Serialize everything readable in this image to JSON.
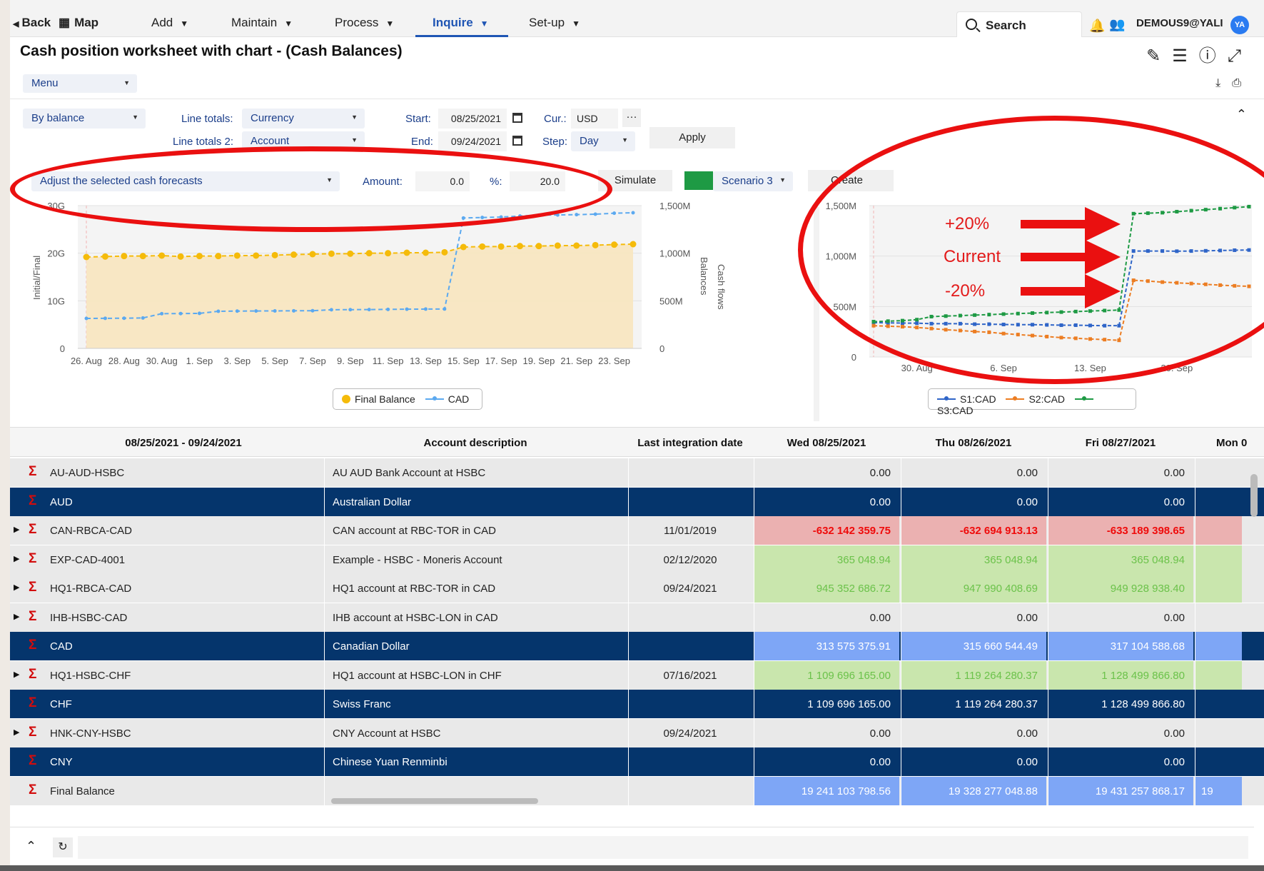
{
  "nav": {
    "back": "Back",
    "map": "Map",
    "items": [
      "Add",
      "Maintain",
      "Process",
      "Inquire",
      "Set-up"
    ],
    "search": "Search",
    "user": "DEMOUS9@YALI",
    "avatar": "YA"
  },
  "page": {
    "title": "Cash position worksheet with chart - (Cash Balances)",
    "menu": "Menu"
  },
  "filters": {
    "view_mode": "By balance",
    "line_totals_label": "Line totals:",
    "line_totals": "Currency",
    "line_totals2_label": "Line totals 2:",
    "line_totals2": "Account",
    "start_label": "Start:",
    "start": "08/25/2021",
    "end_label": "End:",
    "end": "09/24/2021",
    "cur_label": "Cur.:",
    "cur": "USD",
    "step_label": "Step:",
    "step": "Day",
    "apply": "Apply",
    "ellipsis": "···"
  },
  "simulation": {
    "action": "Adjust the selected cash forecasts",
    "amount_label": "Amount:",
    "amount": "0.0",
    "percent_label": "%:",
    "percent": "20.0",
    "simulate": "Simulate",
    "scenario": "Scenario 3",
    "create": "Create",
    "scenario_color": "#1e9a44"
  },
  "chart_data": [
    {
      "type": "line",
      "categories": [
        "26. Aug",
        "27. Aug",
        "28. Aug",
        "29. Aug",
        "30. Aug",
        "31. Aug",
        "1. Sep",
        "2. Sep",
        "3. Sep",
        "4. Sep",
        "5. Sep",
        "6. Sep",
        "7. Sep",
        "8. Sep",
        "9. Sep",
        "10. Sep",
        "11. Sep",
        "12. Sep",
        "13. Sep",
        "14. Sep",
        "15. Sep",
        "16. Sep",
        "17. Sep",
        "18. Sep",
        "19. Sep",
        "20. Sep",
        "21. Sep",
        "22. Sep",
        "23. Sep",
        "24. Sep"
      ],
      "x_tick_labels": [
        "26. Aug",
        "28. Aug",
        "30. Aug",
        "1. Sep",
        "3. Sep",
        "5. Sep",
        "7. Sep",
        "9. Sep",
        "11. Sep",
        "13. Sep",
        "15. Sep",
        "17. Sep",
        "19. Sep",
        "21. Sep",
        "23. Sep"
      ],
      "ylabel": "Initial/Final",
      "y2label": "Balances",
      "y3label": "Cash flows",
      "y_ticks": [
        "0",
        "10G",
        "20G",
        "30G"
      ],
      "y2_ticks": [
        "0",
        "500M",
        "1,000M",
        "1,500M"
      ],
      "ylim": [
        0,
        30
      ],
      "y2lim": [
        0,
        1500
      ],
      "series": [
        {
          "name": "Final Balance",
          "axis": "left",
          "color": "#f5bb0a",
          "values": [
            19.2,
            19.3,
            19.4,
            19.4,
            19.5,
            19.3,
            19.4,
            19.4,
            19.5,
            19.5,
            19.6,
            19.7,
            19.8,
            19.9,
            19.9,
            20.0,
            20.0,
            20.1,
            20.1,
            20.2,
            21.3,
            21.4,
            21.4,
            21.5,
            21.5,
            21.6,
            21.6,
            21.7,
            21.8,
            21.9
          ]
        },
        {
          "name": "CAD",
          "axis": "right",
          "color": "#5ba9f0",
          "values": [
            315,
            316,
            317,
            320,
            365,
            366,
            368,
            390,
            392,
            393,
            394,
            395,
            396,
            406,
            407,
            408,
            410,
            412,
            413,
            414,
            1370,
            1375,
            1380,
            1390,
            1400,
            1402,
            1405,
            1410,
            1420,
            1425
          ]
        }
      ]
    },
    {
      "type": "line",
      "x_tick_labels": [
        "30. Aug",
        "6. Sep",
        "13. Sep",
        "20. Sep"
      ],
      "y_ticks": [
        "0",
        "500M",
        "1,000M",
        "1,500M"
      ],
      "ylim": [
        0,
        1500
      ],
      "series": [
        {
          "name": "S1:CAD",
          "color": "#2f65c8",
          "values": [
            340,
            338,
            336,
            335,
            330,
            330,
            330,
            325,
            325,
            322,
            320,
            320,
            318,
            315,
            315,
            312,
            310,
            310,
            1050,
            1050,
            1050,
            1048,
            1050,
            1052,
            1055,
            1058,
            1060
          ]
        },
        {
          "name": "S2:CAD",
          "color": "#ec7d22",
          "values": [
            310,
            305,
            300,
            292,
            282,
            270,
            262,
            252,
            245,
            232,
            222,
            212,
            202,
            192,
            185,
            178,
            172,
            165,
            760,
            752,
            742,
            735,
            728,
            720,
            712,
            705,
            700
          ]
        },
        {
          "name": "S3:CAD",
          "color": "#1e9a44",
          "values": [
            350,
            355,
            360,
            370,
            400,
            405,
            410,
            415,
            420,
            425,
            430,
            435,
            440,
            445,
            450,
            455,
            460,
            465,
            1420,
            1425,
            1430,
            1440,
            1450,
            1460,
            1470,
            1480,
            1490
          ]
        }
      ]
    }
  ],
  "annotations": {
    "labels": [
      "+20%",
      "Current",
      "-20%"
    ],
    "color": "#e31b1b"
  },
  "table": {
    "columns": [
      "08/25/2021 - 09/24/2021",
      "Account description",
      "Last integration date",
      "Wed 08/25/2021",
      "Thu 08/26/2021",
      "Fri 08/27/2021",
      "Mon 0"
    ],
    "rows": [
      {
        "account": "AU-AUD-HSBC",
        "desc": "AU AUD Bank Account at HSBC",
        "date": "",
        "v1": "0.00",
        "v2": "0.00",
        "v3": "0.00",
        "v4": ""
      },
      {
        "account": "AUD",
        "desc": "Australian Dollar",
        "date": "",
        "v1": "0.00",
        "v2": "0.00",
        "v3": "0.00",
        "v4": ""
      },
      {
        "account": "CAN-RBCA-CAD",
        "desc": "CAN account at RBC-TOR in CAD",
        "date": "11/01/2019",
        "v1": "-632 142 359.75",
        "v2": "-632 694 913.13",
        "v3": "-633 189 398.65",
        "v4": ""
      },
      {
        "account": "EXP-CAD-4001",
        "desc": "Example - HSBC - Moneris Account",
        "date": "02/12/2020",
        "v1": "365 048.94",
        "v2": "365 048.94",
        "v3": "365 048.94",
        "v4": ""
      },
      {
        "account": "HQ1-RBCA-CAD",
        "desc": "HQ1 account at RBC-TOR in CAD",
        "date": "09/24/2021",
        "v1": "945 352 686.72",
        "v2": "947 990 408.69",
        "v3": "949 928 938.40",
        "v4": ""
      },
      {
        "account": "IHB-HSBC-CAD",
        "desc": "IHB account at HSBC-LON in CAD",
        "date": "",
        "v1": "0.00",
        "v2": "0.00",
        "v3": "0.00",
        "v4": ""
      },
      {
        "account": "CAD",
        "desc": "Canadian Dollar",
        "date": "",
        "v1": "313 575 375.91",
        "v2": "315 660 544.49",
        "v3": "317 104 588.68",
        "v4": ""
      },
      {
        "account": "HQ1-HSBC-CHF",
        "desc": "HQ1 account at HSBC-LON in CHF",
        "date": "07/16/2021",
        "v1": "1 109 696 165.00",
        "v2": "1 119 264 280.37",
        "v3": "1 128 499 866.80",
        "v4": ""
      },
      {
        "account": "CHF",
        "desc": "Swiss Franc",
        "date": "",
        "v1": "1 109 696 165.00",
        "v2": "1 119 264 280.37",
        "v3": "1 128 499 866.80",
        "v4": ""
      },
      {
        "account": "HNK-CNY-HSBC",
        "desc": "CNY Account at HSBC",
        "date": "09/24/2021",
        "v1": "0.00",
        "v2": "0.00",
        "v3": "0.00",
        "v4": ""
      },
      {
        "account": "CNY",
        "desc": "Chinese Yuan Renminbi",
        "date": "",
        "v1": "0.00",
        "v2": "0.00",
        "v3": "0.00",
        "v4": ""
      },
      {
        "account": "Final Balance",
        "desc": "",
        "date": "",
        "v1": "19 241 103 798.56",
        "v2": "19 328 277 048.88",
        "v3": "19 431 257 868.17",
        "v4": "19"
      }
    ]
  }
}
